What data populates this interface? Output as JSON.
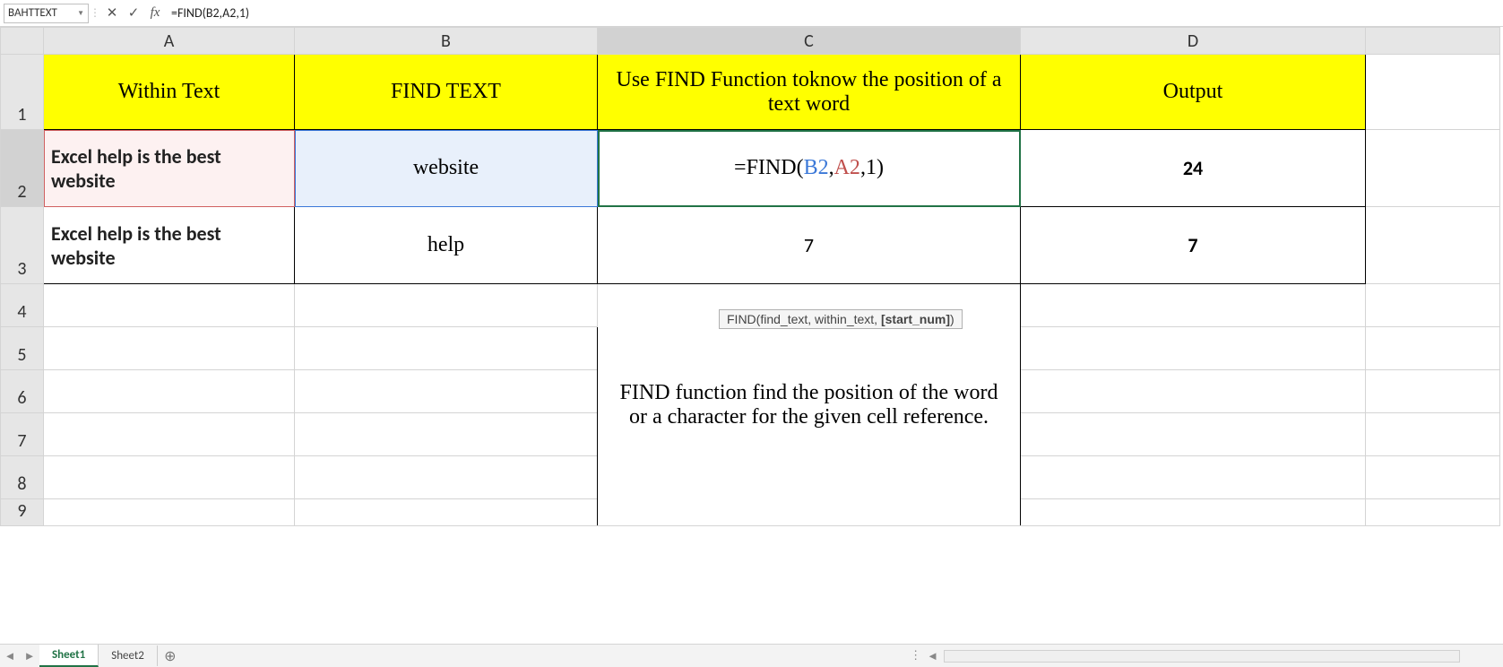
{
  "formula_bar": {
    "name_box": "BAHTTEXT",
    "formula": "=FIND(B2,A2,1)"
  },
  "columns": [
    "A",
    "B",
    "C",
    "D"
  ],
  "rows": [
    "1",
    "2",
    "3",
    "4",
    "5",
    "6",
    "7",
    "8",
    "9"
  ],
  "headers": {
    "A": "Within Text",
    "B": "FIND TEXT",
    "C": "Use FIND Function toknow the position of a text word",
    "D": "Output"
  },
  "data": {
    "A2": "Excel help is the best website",
    "B2": "website",
    "C2_prefix": "=FIND(",
    "C2_b2": "B2",
    "C2_a2": "A2",
    "C2_tail": ",1)",
    "D2": "24",
    "A3": "Excel help is the best website",
    "B3": "help",
    "C3": "7",
    "D3": "7"
  },
  "tooltip": {
    "fn": "FIND",
    "args": "(find_text, within_text, ",
    "bold_arg": "[start_num]",
    "close": ")"
  },
  "note": "FIND function find the position of the word or a character for the given cell reference.",
  "sheets": {
    "active": "Sheet1",
    "other": "Sheet2"
  }
}
